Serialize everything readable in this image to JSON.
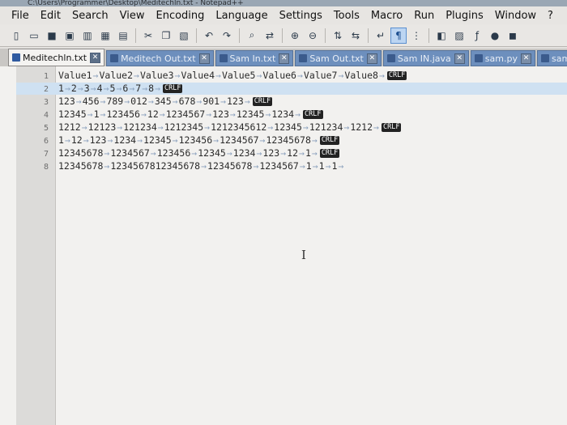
{
  "window": {
    "title": "C:\\Users\\Programmer\\Desktop\\Meditechln.txt - Notepad++"
  },
  "menu": [
    "File",
    "Edit",
    "Search",
    "View",
    "Encoding",
    "Language",
    "Settings",
    "Tools",
    "Macro",
    "Run",
    "Plugins",
    "Window",
    "?"
  ],
  "toolbar": {
    "icons": [
      "new-file-icon",
      "open-file-icon",
      "save-icon",
      "save-all-icon",
      "close-icon",
      "close-all-icon",
      "print-icon",
      "cut-icon",
      "copy-icon",
      "paste-icon",
      "undo-icon",
      "redo-icon",
      "find-icon",
      "replace-icon",
      "zoom-in-icon",
      "zoom-out-icon",
      "sync-vertical-icon",
      "sync-horizontal-icon",
      "word-wrap-icon",
      "show-all-characters-icon",
      "indent-guide-icon",
      "user-language-icon",
      "doc-map-icon",
      "function-list-icon",
      "macro-record-icon",
      "macro-stop-icon"
    ],
    "active_icon": "show-all-characters-icon"
  },
  "tabs": [
    {
      "label": "Meditechln.txt",
      "active": true
    },
    {
      "label": "Meditech Out.txt",
      "active": false
    },
    {
      "label": "Sam In.txt",
      "active": false
    },
    {
      "label": "Sam Out.txt",
      "active": false
    },
    {
      "label": "Sam IN.java",
      "active": false
    },
    {
      "label": "sam.py",
      "active": false
    },
    {
      "label": "samOut.java",
      "active": false
    }
  ],
  "editor": {
    "crlf_label": "CRLF",
    "lines": [
      {
        "n": "1",
        "tokens": [
          "Value1",
          "Value2",
          "Value3",
          "Value4",
          "Value5",
          "Value6",
          "Value7",
          "Value8"
        ],
        "crlf": true
      },
      {
        "n": "2",
        "tokens": [
          "1",
          "2",
          "3",
          "4",
          "5",
          "6",
          "7",
          "8"
        ],
        "crlf": true
      },
      {
        "n": "3",
        "tokens": [
          "123",
          "456",
          "789",
          "012",
          "345",
          "678",
          "901",
          "123"
        ],
        "crlf": true
      },
      {
        "n": "4",
        "tokens": [
          "12345",
          "1",
          "123456",
          "12",
          "1234567",
          "123",
          "12345",
          "1234"
        ],
        "crlf": true
      },
      {
        "n": "5",
        "tokens": [
          "1212",
          "12123",
          "121234",
          "1212345",
          "1212345612",
          "12345",
          "121234",
          "1212"
        ],
        "crlf": true
      },
      {
        "n": "6",
        "tokens": [
          "1",
          "12",
          "123",
          "1234",
          "12345",
          "123456",
          "1234567",
          "12345678"
        ],
        "crlf": true
      },
      {
        "n": "7",
        "tokens": [
          "12345678",
          "1234567",
          "123456",
          "12345",
          "1234",
          "123",
          "12",
          "1"
        ],
        "crlf": true
      },
      {
        "n": "8",
        "tokens": [
          "12345678",
          "1234567812345678",
          "12345678",
          "1234567",
          "1",
          "1",
          "1"
        ],
        "crlf": false
      }
    ]
  },
  "colors": {
    "tab_inactive": "#6d8fbd",
    "current_line": "#cfe1f2",
    "crlf_badge": "#222222"
  }
}
